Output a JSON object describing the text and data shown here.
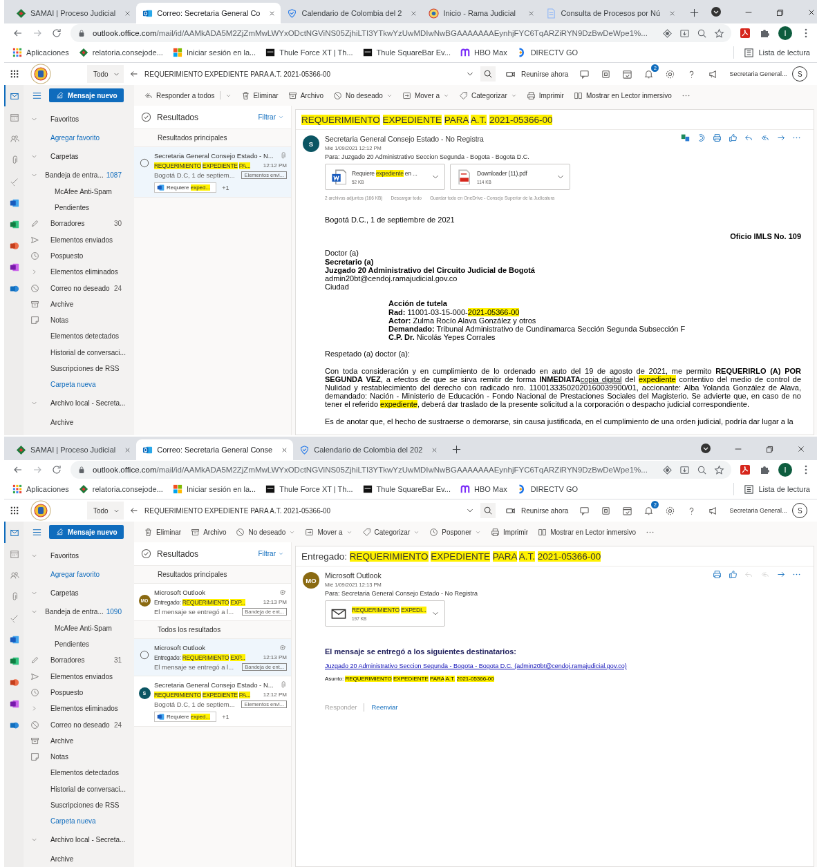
{
  "windows": [
    {
      "tabs": [
        {
          "title": "SAMAI | Proceso Judicial",
          "kind": "samai",
          "selected": false
        },
        {
          "title": "Correo: Secretaria General Co",
          "kind": "outlook",
          "selected": true
        },
        {
          "title": "Calendario de Colombia del 2",
          "kind": "calendar",
          "selected": false
        },
        {
          "title": "Inicio - Rama Judicial",
          "kind": "seal",
          "selected": false
        },
        {
          "title": "Consulta de Procesos por Nú",
          "kind": "document",
          "selected": false
        }
      ],
      "url_host": "outlook.office.com",
      "url_path": "/mail/id/AAMkADA5M2ZjZmMwLWYxODctNGViNS05ZjhiLTI3YTkwYzUwMDIwNwBGAAAAAAAEynhjFYC6TqARZiRYN9DzBwDeWpe1%...",
      "bookmarks": [
        {
          "label": "Aplicaciones",
          "kind": "apps"
        },
        {
          "label": "relatoria.consejode...",
          "kind": "samai"
        },
        {
          "label": "Iniciar sesión en la...",
          "kind": "microsoft"
        },
        {
          "label": "Thule Force XT | Th...",
          "kind": "thule"
        },
        {
          "label": "Thule SquareBar Ev...",
          "kind": "thule"
        },
        {
          "label": "HBO Max",
          "kind": "hbo"
        },
        {
          "label": "DIRECTV GO",
          "kind": "directv"
        }
      ],
      "reading_list": "Lista de lectura",
      "profile": "I",
      "outlook": {
        "scope": "Todo",
        "query": "REQUERIMIENTO EXPEDIENTE PARA A.T. 2021-05366-00",
        "meet": "Reunirse ahora",
        "notifications": "2",
        "account": "Secretaria General...",
        "avatar": "S",
        "app_rail": [
          {
            "kind": "mail",
            "selected": true
          },
          {
            "kind": "calendar",
            "selected": false
          },
          {
            "kind": "people",
            "selected": false
          },
          {
            "kind": "files",
            "selected": false
          },
          {
            "kind": "todo",
            "selected": false
          },
          {
            "kind": "word",
            "selected": false
          },
          {
            "kind": "excel",
            "selected": false
          },
          {
            "kind": "powerpoint",
            "selected": false
          },
          {
            "kind": "onenote",
            "selected": false
          },
          {
            "kind": "yammer",
            "selected": false
          }
        ],
        "new_message": "Mensaje nuevo",
        "commands": [
          {
            "label": "Responder a todos",
            "kind": "reply_all",
            "dropdown": true
          },
          {
            "label": "Eliminar",
            "kind": "delete",
            "dropdown": false
          },
          {
            "label": "Archivo",
            "kind": "archive",
            "dropdown": false
          },
          {
            "label": "No deseado",
            "kind": "junk",
            "dropdown": true
          },
          {
            "label": "Mover a",
            "kind": "move",
            "dropdown": true
          },
          {
            "label": "Categorizar",
            "kind": "categorize",
            "dropdown": true
          },
          {
            "label": "Imprimir",
            "kind": "print",
            "dropdown": false
          },
          {
            "label": "Mostrar en Lector inmersivo",
            "kind": "immersive",
            "dropdown": false
          },
          {
            "kind": "more",
            "dropdown": false
          }
        ],
        "folders": [
          {
            "label": "Favoritos",
            "kind": "section",
            "expanded": true,
            "children": [
              {
                "label": "Agregar favorito",
                "kind": "link"
              }
            ]
          },
          {
            "label": "Carpetas",
            "kind": "section",
            "expanded": true,
            "children": [
              {
                "label": "Bandeja de entra...",
                "kind": "inbox",
                "count": "1087",
                "expanded": true,
                "children": [
                  {
                    "label": "McAfee Anti-Spam",
                    "kind": "plain"
                  },
                  {
                    "label": "Pendientes",
                    "kind": "plain"
                  }
                ]
              },
              {
                "label": "Borradores",
                "kind": "drafts",
                "count": "30"
              },
              {
                "label": "Elementos enviados",
                "kind": "sent"
              },
              {
                "label": "Pospuesto",
                "kind": "snoozed"
              },
              {
                "label": "Elementos eliminados",
                "kind": "deleted",
                "expanded": false
              },
              {
                "label": "Correo no deseado",
                "kind": "junk",
                "count": "24"
              },
              {
                "label": "Archive",
                "kind": "archive"
              },
              {
                "label": "Notas",
                "kind": "notes"
              },
              {
                "label": "Elementos detectados",
                "kind": "plain"
              },
              {
                "label": "Historial de conversaci...",
                "kind": "plain"
              },
              {
                "label": "Suscripciones de RSS",
                "kind": "plain"
              },
              {
                "label": "Carpeta nueva",
                "kind": "link"
              }
            ]
          },
          {
            "label": "Archivo local - Secreta...",
            "kind": "section",
            "expanded": true,
            "children": [
              {
                "label": "Archive",
                "kind": "plain"
              }
            ]
          }
        ],
        "list": {
          "title": "Resultados",
          "filter": "Filtrar",
          "groups": [
            {
              "heading": "Resultados principales",
              "messages": [
                {
                  "selected": true,
                  "kind": "attachment",
                  "sender": "Secretaria General Consejo Estado - N...",
                  "subject": [
                    {
                      "text": "REQUERIMIENTO",
                      "highlighted": true
                    },
                    {
                      "text": "EXPEDIENTE",
                      "highlighted": true
                    },
                    {
                      "text": "PA...",
                      "highlighted": true
                    }
                  ],
                  "time": "12:12 PM",
                  "preview": "Bogotá D.C, 1 de septiem...",
                  "folder": "Elementos envi...",
                  "chip": [
                    {
                      "text": "Requiere",
                      "highlighted": false
                    },
                    {
                      "text": "exped...",
                      "highlighted": true
                    }
                  ],
                  "chip_more": "+1"
                }
              ]
            }
          ]
        },
        "reading": {
          "subject": [
            {
              "text": "REQUERIMIENTO",
              "highlighted": true
            },
            {
              "text": "EXPEDIENTE",
              "highlighted": true
            },
            {
              "text": "PARA",
              "highlighted": true
            },
            {
              "text": "A.T.",
              "highlighted": true
            },
            {
              "text": "2021-05366-00",
              "highlighted": true
            }
          ],
          "avatar": "S",
          "color": "#0b5563",
          "sender": "Secretaria General Consejo Estado - No Registra",
          "date": "Mié 1/09/2021 12:12 PM",
          "to": "Para:  Juzgado 20 Administrativo Seccion Segunda - Bogota - Bogota D.C.",
          "actions": [
            {
              "kind": "translate",
              "disabled": false
            },
            {
              "kind": "loop",
              "disabled": false
            },
            {
              "kind": "print",
              "disabled": false
            },
            {
              "kind": "like",
              "disabled": false
            },
            {
              "kind": "reply",
              "disabled": false
            },
            {
              "kind": "reply_all",
              "disabled": false
            },
            {
              "kind": "forward",
              "disabled": false
            },
            {
              "kind": "more",
              "disabled": false
            }
          ],
          "attachments": [
            {
              "kind": "word",
              "name": [
                {
                  "text": "Requiere",
                  "highlighted": false
                },
                {
                  "text": "expediente",
                  "highlighted": true
                },
                {
                  "text": "en ...",
                  "highlighted": false
                }
              ],
              "size": "52 KB"
            },
            {
              "kind": "pdf",
              "name": [
                {
                  "text": "Downloader (11).pdf",
                  "highlighted": false
                }
              ],
              "size": "114 KB"
            }
          ],
          "attachment_summary": "2 archivos adjuntos (166 KB)",
          "attachment_links": [
            "Descargar todo",
            "Guardar todo en OneDrive - Consejo Superior de la Judicatura"
          ],
          "body": [
            {
              "kind": "lines",
              "lines": [
                {
                  "kind": "plain",
                  "segments": [
                    {
                      "text": "Bogotá D.C., 1 de septiembre de 2021",
                      "highlighted": false
                    }
                  ]
                }
              ]
            },
            {
              "kind": "right_lines",
              "lines": [
                {
                  "kind": "strong",
                  "segments": [
                    {
                      "text": "Oficio IMLS No. 109",
                      "highlighted": false
                    }
                  ]
                }
              ]
            },
            {
              "kind": "lines",
              "lines": [
                {
                  "kind": "plain",
                  "segments": [
                    {
                      "text": "Doctor (a)",
                      "highlighted": false
                    }
                  ]
                },
                {
                  "kind": "strong",
                  "segments": [
                    {
                      "text": "Secretario (a)",
                      "highlighted": false
                    }
                  ]
                },
                {
                  "kind": "strong",
                  "segments": [
                    {
                      "text": "Juzgado 20 Administrativo del Circuito Judicial de Bogotá",
                      "highlighted": false
                    }
                  ]
                },
                {
                  "kind": "plain",
                  "segments": [
                    {
                      "text": "admin20bt@cendoj.ramajudicial.gov.co",
                      "highlighted": false
                    }
                  ]
                },
                {
                  "kind": "plain",
                  "segments": [
                    {
                      "text": "Ciudad",
                      "highlighted": false
                    }
                  ]
                }
              ]
            },
            {
              "kind": "indented_lines",
              "lines": [
                {
                  "kind": "strong",
                  "segments": [
                    {
                      "text": "Acción de tutela",
                      "highlighted": false
                    }
                  ]
                },
                {
                  "kind": "plain",
                  "segments": [
                    {
                      "text": "**Rad:** 11001-03-15-000-",
                      "highlighted": false
                    },
                    {
                      "text": "2021-05366-00",
                      "highlighted": true
                    }
                  ]
                },
                {
                  "kind": "plain",
                  "segments": [
                    {
                      "text": "**Actor:** Zulma Rocío Alava González y otros",
                      "highlighted": false
                    }
                  ]
                },
                {
                  "kind": "plain",
                  "segments": [
                    {
                      "text": "**Demandado:** Tribunal Administrativo de Cundinamarca Sección Segunda Subsección F",
                      "highlighted": false
                    }
                  ]
                },
                {
                  "kind": "plain",
                  "segments": [
                    {
                      "text": "**C.P. Dr.** Nicolás Yepes Corrales",
                      "highlighted": false
                    }
                  ]
                }
              ]
            },
            {
              "kind": "lines",
              "lines": [
                {
                  "kind": "plain",
                  "segments": [
                    {
                      "text": "Respetado (a) doctor (a):",
                      "highlighted": false
                    }
                  ]
                }
              ]
            },
            {
              "kind": "paragraph",
              "segments": [
                {
                  "text": "Con toda consideración y en cumplimiento de lo ordenado en auto del 19 de agosto de 2021, me permito **REQUERIRLO (A) POR SEGUNDA VEZ**, a efectos de que se sirva remitir de forma **INMEDIATA**",
                  "highlighted": false,
                  "underlined": false
                },
                {
                  "text": "copia digital",
                  "highlighted": false,
                  "underlined": true
                },
                {
                  "text": " del ",
                  "highlighted": false,
                  "underlined": false
                },
                {
                  "text": "expediente",
                  "highlighted": true,
                  "underlined": false
                },
                {
                  "text": " contentivo del medio de control de Nulidad y restablecimiento del derecho con radicado nro. 11001333502020160039900/01, accionante: Alba Yolanda González de Alava, demandado: Nación - Ministerio de Educación - Fondo Nacional de Prestaciones Sociales del Magisterio. Se advierte que, en caso de no tener el referido ",
                  "highlighted": false,
                  "underlined": false
                },
                {
                  "text": "expediente",
                  "highlighted": true,
                  "underlined": false
                },
                {
                  "text": ", deberá dar traslado de la presente solicitud a la corporación o despacho judicial correspondiente.",
                  "highlighted": false,
                  "underlined": false
                }
              ]
            },
            {
              "kind": "paragraph",
              "segments": [
                {
                  "text": "Es de anotar que, el hecho de sustraerse o demorarse, sin causa justificada, en el cumplimiento de una orden judicial, podría dar lugar a la",
                  "highlighted": false,
                  "underlined": false
                }
              ]
            }
          ]
        }
      }
    },
    {
      "tabs": [
        {
          "title": "SAMAI | Proceso Judicial",
          "kind": "samai",
          "selected": false
        },
        {
          "title": "Correo: Secretaria General Conse",
          "kind": "outlook",
          "selected": true
        },
        {
          "title": "Calendario de Colombia del 202",
          "kind": "calendar",
          "selected": false
        }
      ],
      "url_host": "outlook.office.com",
      "url_path": "/mail/id/AAMkADA5M2ZjZmMwLWYxODctNGViNS05ZjhiLTI3YTkwYzUwMDIwNwBGAAAAAAAEynhjFYC6TqARZiRYN9DzBwDeWpe1%...",
      "bookmarks": [
        {
          "label": "Aplicaciones",
          "kind": "apps"
        },
        {
          "label": "relatoria.consejode...",
          "kind": "samai"
        },
        {
          "label": "Iniciar sesión en la...",
          "kind": "microsoft"
        },
        {
          "label": "Thule Force XT | Th...",
          "kind": "thule"
        },
        {
          "label": "Thule SquareBar Ev...",
          "kind": "thule"
        },
        {
          "label": "HBO Max",
          "kind": "hbo"
        },
        {
          "label": "DIRECTV GO",
          "kind": "directv"
        }
      ],
      "reading_list": "Lista de lectura",
      "profile": "I",
      "outlook": {
        "scope": "Todo",
        "query": "REQUERIMIENTO EXPEDIENTE PARA A.T. 2021-05366-00",
        "meet": "Reunirse ahora",
        "notifications": "2",
        "account": "Secretaria General...",
        "avatar": "S",
        "app_rail": [
          {
            "kind": "mail",
            "selected": true
          },
          {
            "kind": "calendar",
            "selected": false
          },
          {
            "kind": "people",
            "selected": false
          },
          {
            "kind": "files",
            "selected": false
          },
          {
            "kind": "todo",
            "selected": false
          },
          {
            "kind": "word",
            "selected": false
          },
          {
            "kind": "excel",
            "selected": false
          },
          {
            "kind": "powerpoint",
            "selected": false
          },
          {
            "kind": "onenote",
            "selected": false
          },
          {
            "kind": "yammer",
            "selected": false
          }
        ],
        "new_message": "Mensaje nuevo",
        "commands": [
          {
            "label": "Eliminar",
            "kind": "delete",
            "dropdown": false
          },
          {
            "label": "Archivo",
            "kind": "archive",
            "dropdown": false
          },
          {
            "label": "No deseado",
            "kind": "junk",
            "dropdown": true
          },
          {
            "label": "Mover a",
            "kind": "move",
            "dropdown": true
          },
          {
            "label": "Categorizar",
            "kind": "categorize",
            "dropdown": true
          },
          {
            "label": "Posponer",
            "kind": "snooze",
            "dropdown": true
          },
          {
            "label": "Imprimir",
            "kind": "print",
            "dropdown": false
          },
          {
            "label": "Mostrar en Lector inmersivo",
            "kind": "immersive",
            "dropdown": false
          },
          {
            "kind": "more",
            "dropdown": false
          }
        ],
        "folders": [
          {
            "label": "Favoritos",
            "kind": "section",
            "expanded": true,
            "children": [
              {
                "label": "Agregar favorito",
                "kind": "link"
              }
            ]
          },
          {
            "label": "Carpetas",
            "kind": "section",
            "expanded": true,
            "children": [
              {
                "label": "Bandeja de entra...",
                "kind": "inbox",
                "count": "1090",
                "expanded": true,
                "children": [
                  {
                    "label": "McAfee Anti-Spam",
                    "kind": "plain"
                  },
                  {
                    "label": "Pendientes",
                    "kind": "plain"
                  }
                ]
              },
              {
                "label": "Borradores",
                "kind": "drafts",
                "count": "31"
              },
              {
                "label": "Elementos enviados",
                "kind": "sent"
              },
              {
                "label": "Pospuesto",
                "kind": "snoozed"
              },
              {
                "label": "Elementos eliminados",
                "kind": "deleted",
                "expanded": false
              },
              {
                "label": "Correo no deseado",
                "kind": "junk",
                "count": "24"
              },
              {
                "label": "Archive",
                "kind": "archive"
              },
              {
                "label": "Notas",
                "kind": "notes"
              },
              {
                "label": "Elementos detectados",
                "kind": "plain"
              },
              {
                "label": "Historial de conversaci...",
                "kind": "plain"
              },
              {
                "label": "Suscripciones de RSS",
                "kind": "plain"
              },
              {
                "label": "Carpeta nueva",
                "kind": "link"
              }
            ]
          },
          {
            "label": "Archivo local - Secreta...",
            "kind": "section",
            "expanded": true,
            "children": [
              {
                "label": "Archive",
                "kind": "plain"
              }
            ]
          }
        ],
        "list": {
          "title": "Resultados",
          "filter": "Filtrar",
          "groups": [
            {
              "heading": "Resultados principales",
              "messages": [
                {
                  "selected": false,
                  "kind": "receipt",
                  "avatar": "MO",
                  "color": "#8a6a12",
                  "sender": "Microsoft Outlook",
                  "subject": [
                    {
                      "text": "Entregado:",
                      "highlighted": false
                    },
                    {
                      "text": "REQUERIMIENTO",
                      "highlighted": true
                    },
                    {
                      "text": "EXP...",
                      "highlighted": true
                    }
                  ],
                  "time": "12:13 PM",
                  "preview": "El mensaje se entregó a l...",
                  "folder": "Bandeja de ent..."
                }
              ]
            },
            {
              "heading": "Todos los resultados",
              "messages": [
                {
                  "selected": true,
                  "kind": "receipt",
                  "sender": "Microsoft Outlook",
                  "subject": [
                    {
                      "text": "Entregado:",
                      "highlighted": false
                    },
                    {
                      "text": "REQUERIMIENTO",
                      "highlighted": true
                    },
                    {
                      "text": "EXP...",
                      "highlighted": true
                    }
                  ],
                  "time": "12:13 PM",
                  "preview": "El mensaje se entregó a l...",
                  "folder": "Bandeja de ent..."
                },
                {
                  "selected": false,
                  "kind": "attachment",
                  "avatar": "S",
                  "color": "#0b5563",
                  "sender": "Secretaria General Consejo Estado - N...",
                  "subject": [
                    {
                      "text": "REQUERIMIENTO",
                      "highlighted": true
                    },
                    {
                      "text": "EXPEDIENTE",
                      "highlighted": true
                    },
                    {
                      "text": "PA...",
                      "highlighted": true
                    }
                  ],
                  "time": "12:12 PM",
                  "preview": "Bogotá D.C, 1 de septiem...",
                  "folder": "Elementos envi...",
                  "chip": [
                    {
                      "text": "Requiere",
                      "highlighted": false
                    },
                    {
                      "text": "exped...",
                      "highlighted": true
                    }
                  ],
                  "chip_more": "+1"
                }
              ]
            }
          ]
        },
        "reading": {
          "subject": [
            {
              "text": "Entregado:",
              "highlighted": false
            },
            {
              "text": "REQUERIMIENTO",
              "highlighted": true
            },
            {
              "text": "EXPEDIENTE",
              "highlighted": true
            },
            {
              "text": "PARA",
              "highlighted": true
            },
            {
              "text": "A.T.",
              "highlighted": true
            },
            {
              "text": "2021-05366-00",
              "highlighted": true
            }
          ],
          "avatar": "MO",
          "color": "#8a6a12",
          "sender": "Microsoft Outlook",
          "date": "Mié 1/09/2021 12:13 PM",
          "to": "Para:  Secretaria General Consejo Estado - No Registra",
          "actions": [
            {
              "kind": "print",
              "disabled": false
            },
            {
              "kind": "like",
              "disabled": false
            },
            {
              "kind": "reply",
              "disabled": true
            },
            {
              "kind": "reply_all",
              "disabled": true
            },
            {
              "kind": "forward",
              "disabled": false
            },
            {
              "kind": "more",
              "disabled": false
            }
          ],
          "attachments": [
            {
              "kind": "mail",
              "name": [
                {
                  "text": "REQUERIMIENTO",
                  "highlighted": true
                },
                {
                  "text": "EXPEDI...",
                  "highlighted": true
                }
              ],
              "size": "197 KB"
            }
          ],
          "body": [
            {
              "kind": "heading",
              "segments": [
                {
                  "text": "El mensaje se entregó a los siguientes destinatarios:",
                  "highlighted": false
                }
              ]
            },
            {
              "kind": "link",
              "segments": [
                {
                  "text": "Juzgado 20 Administrativo Seccion Segunda - Bogota - Bogota D.C. (admin20bt@cendoj.ramajudicial.gov.co)",
                  "highlighted": false
                }
              ]
            },
            {
              "kind": "note",
              "words": [
                {
                  "text": "Asunto:",
                  "highlighted": false
                },
                {
                  "text": "REQUERIMIENTO",
                  "highlighted": true
                },
                {
                  "text": "EXPEDIENTE",
                  "highlighted": true
                },
                {
                  "text": "PARA",
                  "highlighted": true
                },
                {
                  "text": "A.T.",
                  "highlighted": true
                },
                {
                  "text": "2021-05366-00",
                  "highlighted": true
                }
              ]
            }
          ],
          "footer": [
            {
              "label": "Responder",
              "disabled": true
            },
            {
              "label": "Reenviar",
              "disabled": false
            }
          ]
        }
      }
    }
  ]
}
